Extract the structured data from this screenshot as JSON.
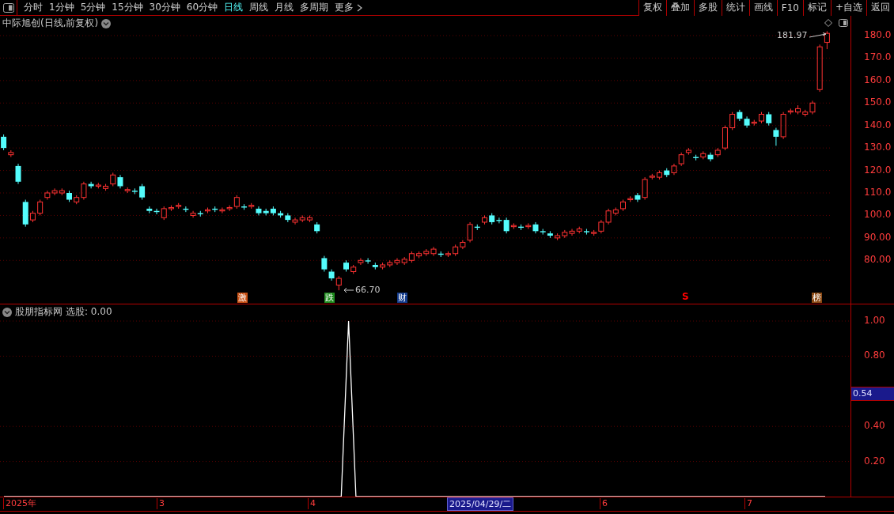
{
  "toolbar": {
    "periods": [
      {
        "label": "分时",
        "selected": false
      },
      {
        "label": "1分钟",
        "selected": false
      },
      {
        "label": "5分钟",
        "selected": false
      },
      {
        "label": "15分钟",
        "selected": false
      },
      {
        "label": "30分钟",
        "selected": false
      },
      {
        "label": "60分钟",
        "selected": false
      },
      {
        "label": "日线",
        "selected": true
      },
      {
        "label": "周线",
        "selected": false
      },
      {
        "label": "月线",
        "selected": false
      },
      {
        "label": "多周期",
        "selected": false
      },
      {
        "label": "更多",
        "selected": false
      }
    ],
    "buttons": [
      "复权",
      "叠加",
      "多股",
      "统计",
      "画线",
      "F10",
      "标记",
      "+自选",
      "返回"
    ]
  },
  "main_chart": {
    "title": "中际旭创(日线,前复权)",
    "high_label": "181.97",
    "low_label": "66.70",
    "chart_data": {
      "type": "candlestick",
      "grid": true,
      "ylim": [
        60.4,
        188.8
      ],
      "categories": [
        null,
        null,
        null,
        null,
        null,
        null,
        null,
        null,
        null,
        null,
        null,
        null,
        null,
        null,
        null,
        null,
        null,
        null,
        null,
        null,
        null,
        null,
        null,
        null,
        null,
        null,
        null,
        null,
        null,
        null,
        null,
        null,
        null,
        null,
        null,
        null,
        null,
        null,
        null,
        null,
        null,
        null,
        null,
        null,
        null,
        null,
        null,
        null,
        null,
        null,
        null,
        null,
        null,
        null,
        null,
        null,
        null,
        null,
        null,
        null,
        null,
        null,
        null,
        null,
        null,
        null,
        null,
        null,
        null,
        null,
        null,
        null,
        null,
        null,
        null,
        null,
        null,
        null,
        null,
        null,
        null,
        null,
        null,
        null,
        null,
        null,
        null,
        null,
        null,
        null,
        null,
        null,
        null,
        null,
        null,
        null,
        null,
        null,
        null,
        null,
        null,
        null,
        null,
        null,
        null,
        null,
        null,
        null,
        null,
        null,
        null,
        null,
        null,
        null
      ],
      "yticks": [
        {
          "value": 180,
          "label": "180.0"
        },
        {
          "value": 170,
          "label": "170.0"
        },
        {
          "value": 160,
          "label": "160.0"
        },
        {
          "value": 150,
          "label": "150.0"
        },
        {
          "value": 140,
          "label": "140.0"
        },
        {
          "value": 130,
          "label": "130.0"
        },
        {
          "value": 120,
          "label": "120.0"
        },
        {
          "value": 110,
          "label": "110.0"
        },
        {
          "value": 100,
          "label": "100.0"
        },
        {
          "value": 90,
          "label": "90.00"
        },
        {
          "value": 80,
          "label": "80.00"
        }
      ],
      "ohlc": [
        [
          135,
          136,
          129,
          130
        ],
        [
          127,
          129,
          126,
          128
        ],
        [
          122,
          123,
          114,
          115
        ],
        [
          106,
          107,
          95,
          96
        ],
        [
          98,
          102,
          97,
          101
        ],
        [
          101,
          107,
          100,
          106
        ],
        [
          108,
          111,
          107,
          110
        ],
        [
          110,
          112,
          109,
          111
        ],
        [
          110,
          112,
          109,
          111
        ],
        [
          110,
          111,
          106,
          107
        ],
        [
          106,
          109,
          105,
          108
        ],
        [
          108,
          115,
          107,
          114
        ],
        [
          114,
          115,
          112,
          113
        ],
        [
          113,
          114.5,
          112,
          113.5
        ],
        [
          112,
          114,
          111,
          113
        ],
        [
          114,
          119,
          113,
          118
        ],
        [
          117,
          118,
          112,
          113
        ],
        [
          111,
          112.5,
          110,
          111.5
        ],
        [
          111,
          112,
          109.5,
          110.5
        ],
        [
          113,
          114,
          107,
          108
        ],
        [
          103,
          104,
          101,
          102
        ],
        [
          102,
          103,
          100.5,
          101.5
        ],
        [
          99,
          104,
          98,
          103
        ],
        [
          103,
          104.5,
          102,
          103.5
        ],
        [
          104,
          105.5,
          103,
          104.5
        ],
        [
          103,
          104,
          101.5,
          102.5
        ],
        [
          100,
          102,
          99,
          101
        ],
        [
          101,
          102,
          99.5,
          100.5
        ],
        [
          102,
          103.5,
          101,
          102.5
        ],
        [
          103,
          104,
          101.5,
          102.5
        ],
        [
          102,
          103.5,
          101,
          102.5
        ],
        [
          103,
          104.5,
          102,
          103.5
        ],
        [
          104,
          109,
          103,
          108
        ],
        [
          104,
          105,
          102.5,
          103.5
        ],
        [
          104,
          105.5,
          103,
          104.5
        ],
        [
          103,
          104,
          100,
          101
        ],
        [
          102,
          103,
          100,
          101
        ],
        [
          103,
          104,
          100,
          101
        ],
        [
          101,
          102,
          99,
          100
        ],
        [
          100,
          101,
          97,
          98
        ],
        [
          97,
          99,
          96,
          98
        ],
        [
          98,
          100,
          97,
          99
        ],
        [
          98,
          100,
          97,
          99
        ],
        [
          96,
          97,
          92,
          93
        ],
        [
          81,
          82,
          75,
          76
        ],
        [
          75,
          76,
          71,
          72
        ],
        [
          69,
          73,
          66.7,
          72
        ],
        [
          79,
          80,
          75,
          76
        ],
        [
          75,
          78,
          74,
          77
        ],
        [
          79,
          81,
          78,
          80
        ],
        [
          80,
          81,
          78.5,
          79.5
        ],
        [
          78,
          79,
          76,
          77
        ],
        [
          77,
          79,
          76,
          78
        ],
        [
          78,
          80,
          77,
          79
        ],
        [
          79,
          81,
          78,
          80
        ],
        [
          79,
          81.5,
          78,
          80.5
        ],
        [
          80,
          84,
          79,
          83
        ],
        [
          82,
          84,
          81,
          83
        ],
        [
          83,
          85,
          82,
          84
        ],
        [
          83,
          86,
          82,
          85
        ],
        [
          83,
          84,
          81.5,
          82.5
        ],
        [
          82.5,
          84,
          81.5,
          83
        ],
        [
          83,
          87,
          82,
          86
        ],
        [
          86,
          89,
          85,
          88
        ],
        [
          89,
          97,
          88,
          96
        ],
        [
          95,
          96,
          93.5,
          94.5
        ],
        [
          97,
          100,
          96,
          99
        ],
        [
          100,
          101,
          96,
          97
        ],
        [
          98,
          99,
          96.5,
          97.5
        ],
        [
          98,
          99,
          92,
          93
        ],
        [
          95,
          96.5,
          94,
          95.5
        ],
        [
          95,
          96,
          93.5,
          94.5
        ],
        [
          95,
          96.5,
          94,
          95.5
        ],
        [
          96,
          97,
          92,
          93
        ],
        [
          93,
          94,
          91.5,
          92.5
        ],
        [
          92,
          93,
          90,
          91
        ],
        [
          90,
          92,
          89,
          91
        ],
        [
          91,
          93.5,
          90,
          92.5
        ],
        [
          92,
          94,
          91,
          93
        ],
        [
          93,
          95,
          92,
          94
        ],
        [
          93,
          94,
          91.5,
          92.5
        ],
        [
          92,
          93.5,
          91,
          92.5
        ],
        [
          93,
          98,
          92,
          97
        ],
        [
          97,
          103,
          96,
          102
        ],
        [
          101,
          103.5,
          100,
          102.5
        ],
        [
          103,
          107,
          102,
          106
        ],
        [
          107,
          108.5,
          106,
          107.5
        ],
        [
          109,
          110,
          106,
          107
        ],
        [
          108,
          117,
          107,
          116
        ],
        [
          117,
          118.5,
          116,
          117.5
        ],
        [
          117,
          120,
          116,
          119
        ],
        [
          120,
          121,
          117,
          118
        ],
        [
          119,
          123,
          118,
          122
        ],
        [
          123,
          128,
          122,
          127
        ],
        [
          128,
          130,
          127,
          129
        ],
        [
          126,
          127,
          124.5,
          125.5
        ],
        [
          126,
          128.5,
          125,
          127.5
        ],
        [
          127,
          128,
          124,
          125
        ],
        [
          127,
          130,
          126,
          129
        ],
        [
          130,
          140,
          129,
          139
        ],
        [
          139,
          146,
          138,
          145
        ],
        [
          146,
          147,
          142,
          143
        ],
        [
          143,
          144,
          139,
          140
        ],
        [
          141,
          142.5,
          140,
          141.5
        ],
        [
          142,
          146,
          141,
          145
        ],
        [
          145,
          146,
          140,
          141
        ],
        [
          138,
          139,
          131,
          135
        ],
        [
          135,
          146,
          134,
          145
        ],
        [
          146,
          147.5,
          145,
          146.5
        ],
        [
          146,
          149,
          145,
          147.5
        ],
        [
          145,
          147,
          144,
          146
        ],
        [
          146,
          151,
          145,
          150
        ],
        [
          156,
          176,
          155,
          175
        ],
        [
          177,
          181.97,
          174,
          181
        ]
      ]
    },
    "markers": [
      {
        "label": "激",
        "kind": "badge",
        "color": "#c85014"
      },
      {
        "label": "跌",
        "kind": "badge",
        "color": "#1e8c1e"
      },
      {
        "label": "财",
        "kind": "badge",
        "color": "#143c8c"
      },
      {
        "label": "S",
        "kind": "signal",
        "color": "#ff0000"
      },
      {
        "label": "榜",
        "kind": "badge",
        "color": "#8c4a14"
      }
    ]
  },
  "indicator": {
    "title": "股朋指标网",
    "reading": "选股: 0.00",
    "cursor_value": "0.54",
    "chart_data": {
      "type": "line",
      "grid": true,
      "ylim": [
        0,
        1
      ],
      "yticks": [
        {
          "value": 1,
          "label": "1.00"
        },
        {
          "value": 0.8,
          "label": "0.80"
        },
        {
          "value": 0.4,
          "label": "0.40"
        },
        {
          "value": 0.2,
          "label": "0.20"
        }
      ],
      "series": [
        {
          "color": "#ffffff",
          "values": [
            0,
            0,
            0,
            0,
            0,
            0,
            0,
            0,
            0,
            0,
            0,
            0,
            0,
            0,
            0,
            0,
            0,
            0,
            0,
            0,
            0,
            0,
            0,
            0,
            0,
            0,
            0,
            0,
            0,
            0,
            0,
            0,
            0,
            0,
            0,
            0,
            0,
            0,
            0,
            0,
            0,
            0,
            0,
            0,
            0,
            0,
            0,
            1,
            0,
            0,
            0,
            0,
            0,
            0,
            0,
            0,
            0,
            0,
            0,
            0,
            0,
            0,
            0,
            0,
            0,
            0,
            0,
            0,
            0,
            0,
            0,
            0,
            0,
            0,
            0,
            0,
            0,
            0,
            0,
            0,
            0,
            0,
            0,
            0,
            0,
            0,
            0,
            0,
            0,
            0,
            0,
            0,
            0,
            0,
            0,
            0,
            0,
            0,
            0,
            0,
            0,
            0,
            0,
            0,
            0,
            0,
            0,
            0,
            0,
            0,
            0,
            0,
            0
          ]
        }
      ]
    }
  },
  "date_axis": {
    "labels": [
      "2025年",
      "3",
      "4",
      "6",
      "7"
    ],
    "cursor_date": "2025/04/29/二"
  }
}
